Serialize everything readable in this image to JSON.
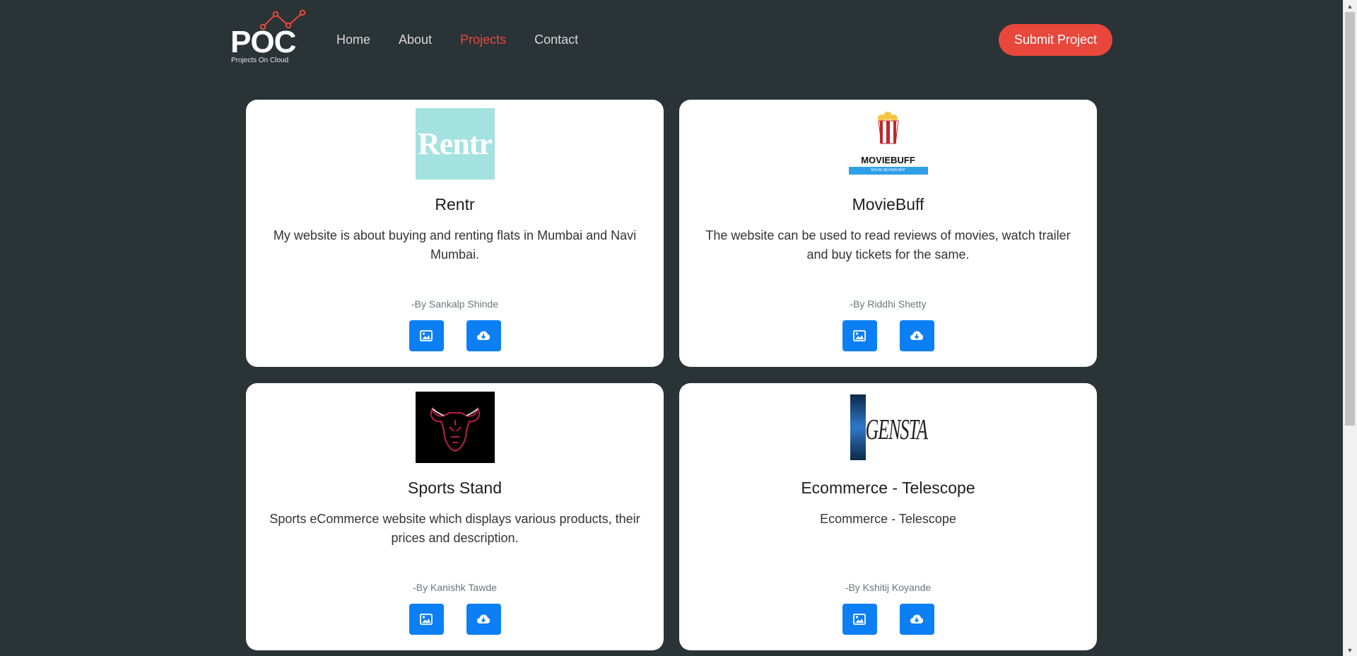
{
  "brand": {
    "logo_text": "POC",
    "tagline": "Projects On Cloud"
  },
  "nav": {
    "links": [
      {
        "label": "Home",
        "active": false
      },
      {
        "label": "About",
        "active": false
      },
      {
        "label": "Projects",
        "active": true
      },
      {
        "label": "Contact",
        "active": false
      }
    ],
    "submit_label": "Submit Project"
  },
  "colors": {
    "background": "#2a3336",
    "accent": "#e8483b",
    "button_blue": "#0d7ff5"
  },
  "projects": [
    {
      "title": "Rentr",
      "description": "My website is about buying and renting flats in Mumbai and Navi Mumbai.",
      "author": "-By Sankalp Shinde",
      "thumb_text": "Rentr"
    },
    {
      "title": "MovieBuff",
      "description": "The website can be used to read reviews of movies, watch trailer and buy tickets for the same.",
      "author": "-By Riddhi Shetty",
      "thumb_text": "MOVIEBUFF",
      "thumb_subtext": "MOVIE REVIEW APP"
    },
    {
      "title": "Sports Stand",
      "description": "Sports eCommerce website which displays various products, their prices and description.",
      "author": "-By Kanishk Tawde",
      "thumb_text": ""
    },
    {
      "title": "Ecommerce - Telescope",
      "description": "Ecommerce - Telescope",
      "author": "-By Kshitij Koyande",
      "thumb_text": "GENSTAR"
    }
  ],
  "icons": {
    "image_button": "image-icon",
    "download_button": "cloud-download-icon"
  }
}
